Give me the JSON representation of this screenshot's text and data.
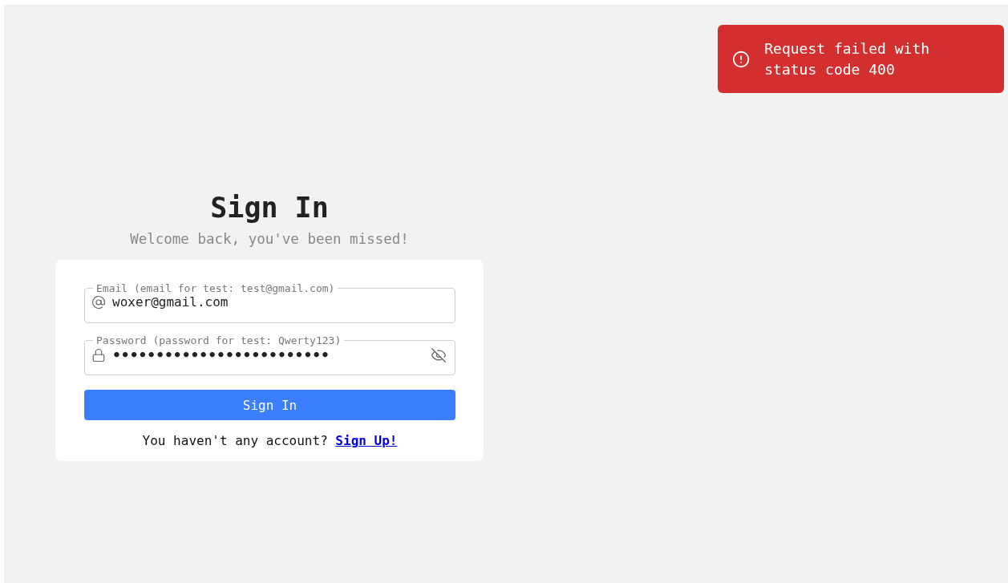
{
  "toast": {
    "kind": "error",
    "message": "Request failed with status code 400"
  },
  "title": "Sign In",
  "subtitle": "Welcome back, you've been missed!",
  "fields": [
    {
      "kind": "email",
      "label": "Email (email for test: test@gmail.com)",
      "value": "woxer@gmail.com"
    },
    {
      "kind": "password",
      "label": "Password (password for test: Qwerty123)",
      "value": "•••••••••••••••••••••••••"
    }
  ],
  "submit": "Sign In",
  "footer": {
    "text": "You haven't any account?",
    "link": "Sign Up!"
  }
}
